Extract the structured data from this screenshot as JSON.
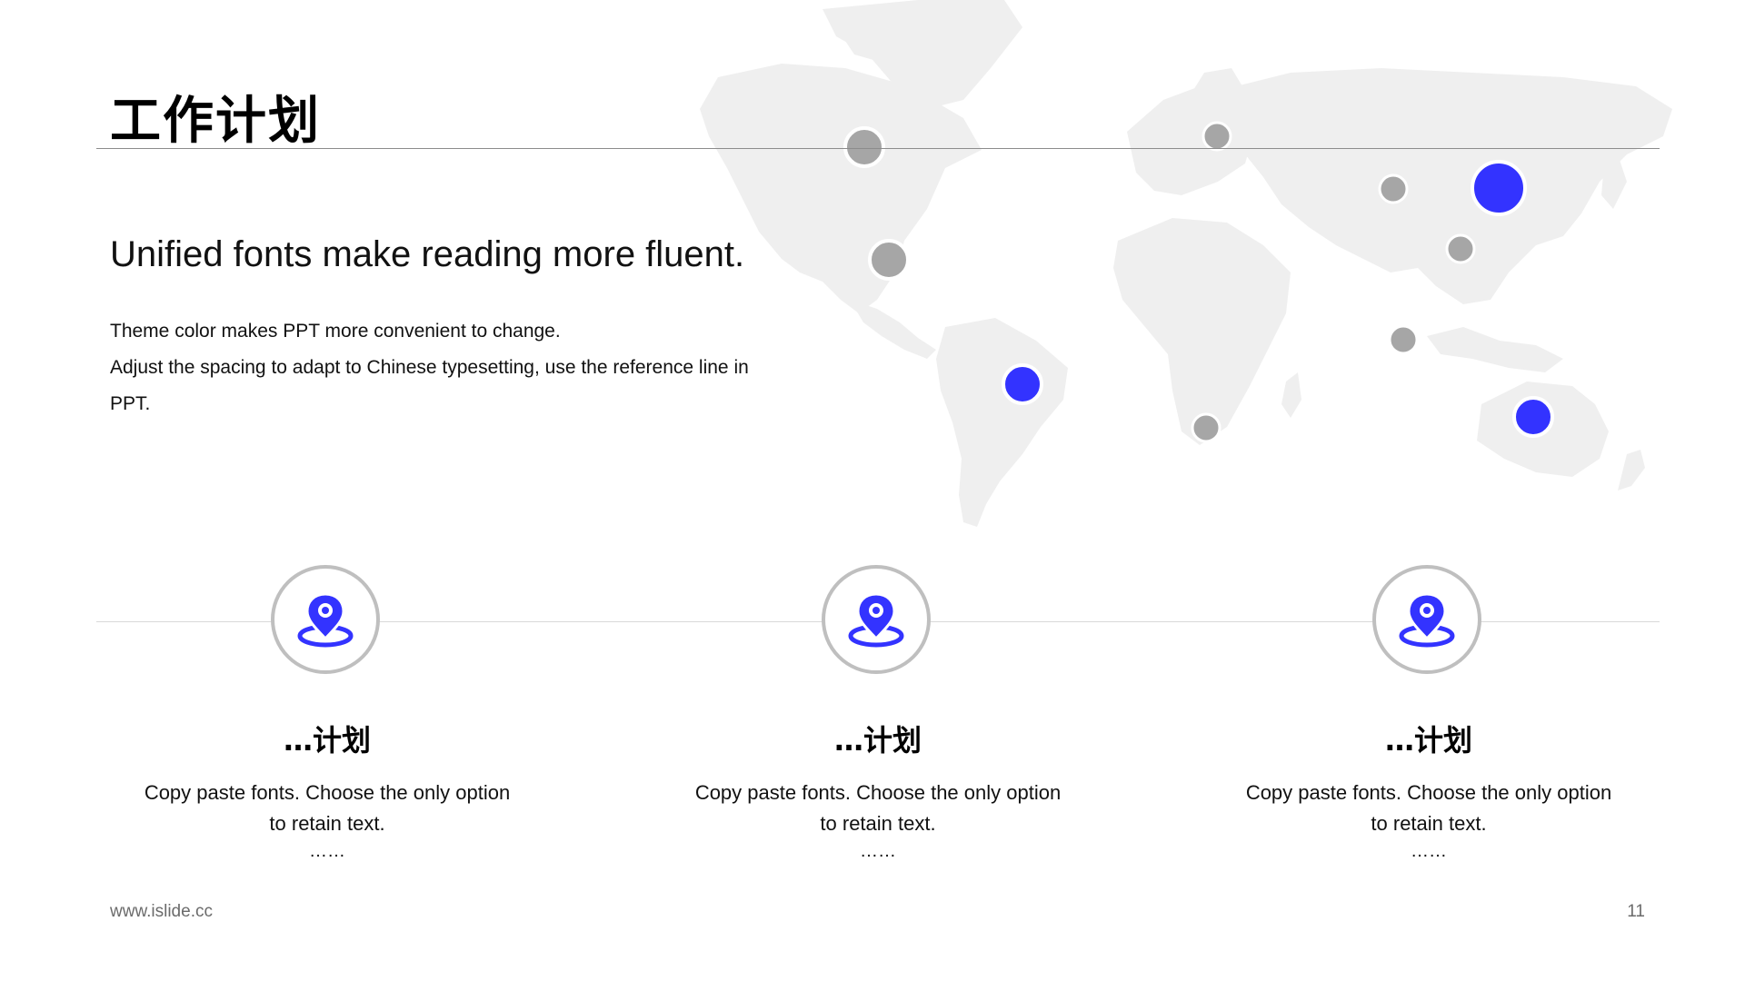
{
  "slide": {
    "title": "工作计划",
    "subtitle": "Unified fonts make reading more fluent.",
    "body_lines": [
      "Theme color makes PPT more convenient to change.",
      "Adjust the spacing to adapt to Chinese typesetting, use the reference line in PPT."
    ]
  },
  "map": {
    "land_color": "#efefef",
    "grey_marker_color": "#a6a6a6",
    "accent_marker_color": "#3333ff",
    "markers": [
      {
        "name": "map-marker-canada",
        "type": "grey"
      },
      {
        "name": "map-marker-usa",
        "type": "grey"
      },
      {
        "name": "map-marker-brazil",
        "type": "accent"
      },
      {
        "name": "map-marker-scandinavia",
        "type": "grey"
      },
      {
        "name": "map-marker-south-africa",
        "type": "grey"
      },
      {
        "name": "map-marker-central-asia",
        "type": "grey"
      },
      {
        "name": "map-marker-china-north",
        "type": "accent"
      },
      {
        "name": "map-marker-china-south",
        "type": "grey"
      },
      {
        "name": "map-marker-southeast-asia",
        "type": "grey"
      },
      {
        "name": "map-marker-australia",
        "type": "accent"
      }
    ]
  },
  "items": [
    {
      "icon": "location-pin-icon",
      "title": "…计划",
      "desc": "Copy paste fonts. Choose the only option to retain text.",
      "ellipsis": "……"
    },
    {
      "icon": "location-pin-icon",
      "title": "…计划",
      "desc": "Copy paste fonts. Choose the only option to retain text.",
      "ellipsis": "……"
    },
    {
      "icon": "location-pin-icon",
      "title": "…计划",
      "desc": "Copy paste fonts. Choose the only option to retain text.",
      "ellipsis": "……"
    }
  ],
  "footer": {
    "url": "www.islide.cc",
    "page_number": "11"
  }
}
